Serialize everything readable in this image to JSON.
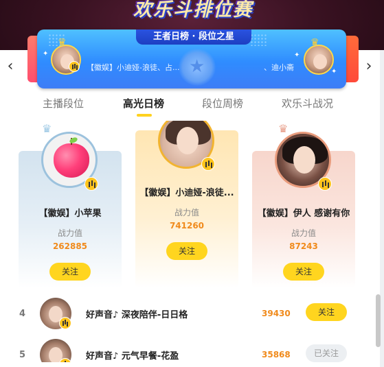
{
  "header": {
    "game_title": "欢乐斗排位赛"
  },
  "promo": {
    "badge": "王者日榜 · 段位之星",
    "left_text": "【徽娱】小迪娅-浪徒、占...",
    "right_text": "、迪小斋"
  },
  "nav": {
    "prev_icon": "‹",
    "next_icon": "›"
  },
  "tabs": [
    {
      "label": "主播段位",
      "active": false
    },
    {
      "label": "高光日榜",
      "active": true
    },
    {
      "label": "段位周榜",
      "active": false
    },
    {
      "label": "欢乐斗战况",
      "active": false
    }
  ],
  "podium": {
    "silver": {
      "name": "【徽娱】小苹果",
      "label": "战力值",
      "value": "262885",
      "button": "关注"
    },
    "gold": {
      "name": "【徽娱】小迪娅-浪徒...",
      "label": "战力值",
      "value": "741260",
      "button": "关注"
    },
    "bronze": {
      "name": "【徽娱】伊人 感谢有你",
      "label": "战力值",
      "value": "87243",
      "button": "关注"
    }
  },
  "rows": [
    {
      "rank": "4",
      "name": "好声音♪ 深夜陪伴-日日格",
      "value": "39430",
      "button": "关注",
      "followed": false
    },
    {
      "rank": "5",
      "name": "好声音♪ 元气早餐-花盈",
      "value": "35868",
      "button": "已关注",
      "followed": true
    }
  ],
  "colors": {
    "accent": "#ffd51f",
    "value": "#f08a1b",
    "promo_blue": "#2f8cff"
  }
}
